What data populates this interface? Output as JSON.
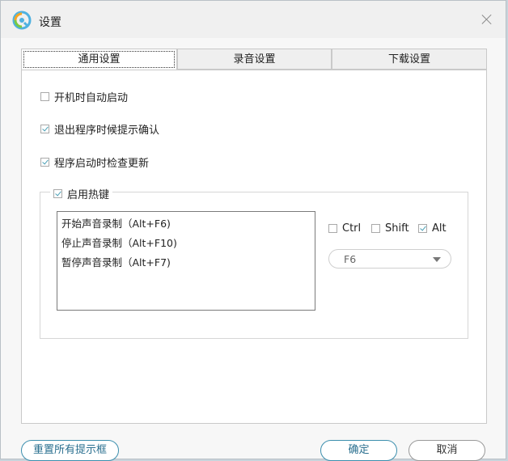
{
  "window": {
    "title": "设置",
    "app_icon": "app-logo-icon",
    "close_icon": "close-icon"
  },
  "tabs": [
    {
      "label": "通用设置",
      "active": true
    },
    {
      "label": "录音设置",
      "active": false
    },
    {
      "label": "下载设置",
      "active": false
    }
  ],
  "general": {
    "autostart": {
      "label": "开机时自动启动",
      "checked": false
    },
    "exit_confirm": {
      "label": "退出程序时候提示确认",
      "checked": true
    },
    "check_update": {
      "label": "程序启动时检查更新",
      "checked": true
    },
    "hotkeys": {
      "label": "启用热键",
      "checked": true,
      "items": [
        "开始声音录制（Alt+F6)",
        "停止声音录制（Alt+F10)",
        "暂停声音录制（Alt+F7)"
      ],
      "modifiers": [
        {
          "label": "Ctrl",
          "checked": false
        },
        {
          "label": "Shift",
          "checked": false
        },
        {
          "label": "Alt",
          "checked": true
        }
      ],
      "key": "F6"
    }
  },
  "buttons": {
    "reset": "重置所有提示框",
    "ok": "确定",
    "cancel": "取消"
  },
  "colors": {
    "accent": "#3c8fae",
    "check": "#4a9fb5"
  }
}
